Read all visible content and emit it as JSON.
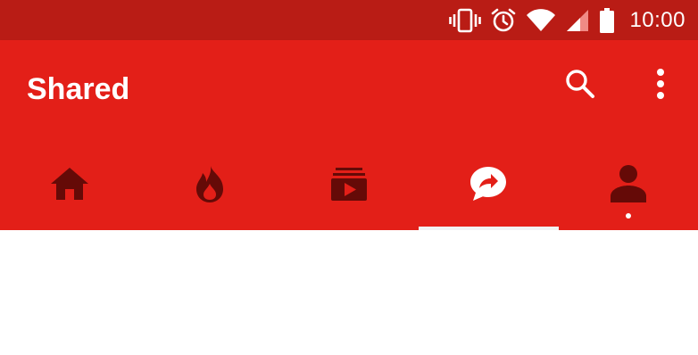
{
  "status_bar": {
    "time": "10:00",
    "icons": [
      "vibrate-icon",
      "alarm-icon",
      "wifi-icon",
      "cell-signal-icon",
      "battery-icon"
    ],
    "color": "#b91c15"
  },
  "app_bar": {
    "title": "Shared",
    "color": "#e31f18",
    "actions": [
      "search-icon",
      "more-vert-icon"
    ]
  },
  "tabs": [
    {
      "icon": "home-icon",
      "selected": false
    },
    {
      "icon": "trending-fire-icon",
      "selected": false
    },
    {
      "icon": "subscriptions-icon",
      "selected": false
    },
    {
      "icon": "shared-icon",
      "selected": true
    },
    {
      "icon": "account-icon",
      "selected": false,
      "has_dot": true
    }
  ],
  "colors": {
    "tab_icon": "#650a07",
    "selected_tab_icon": "#ffffff",
    "indicator": "#f2f2f2"
  }
}
